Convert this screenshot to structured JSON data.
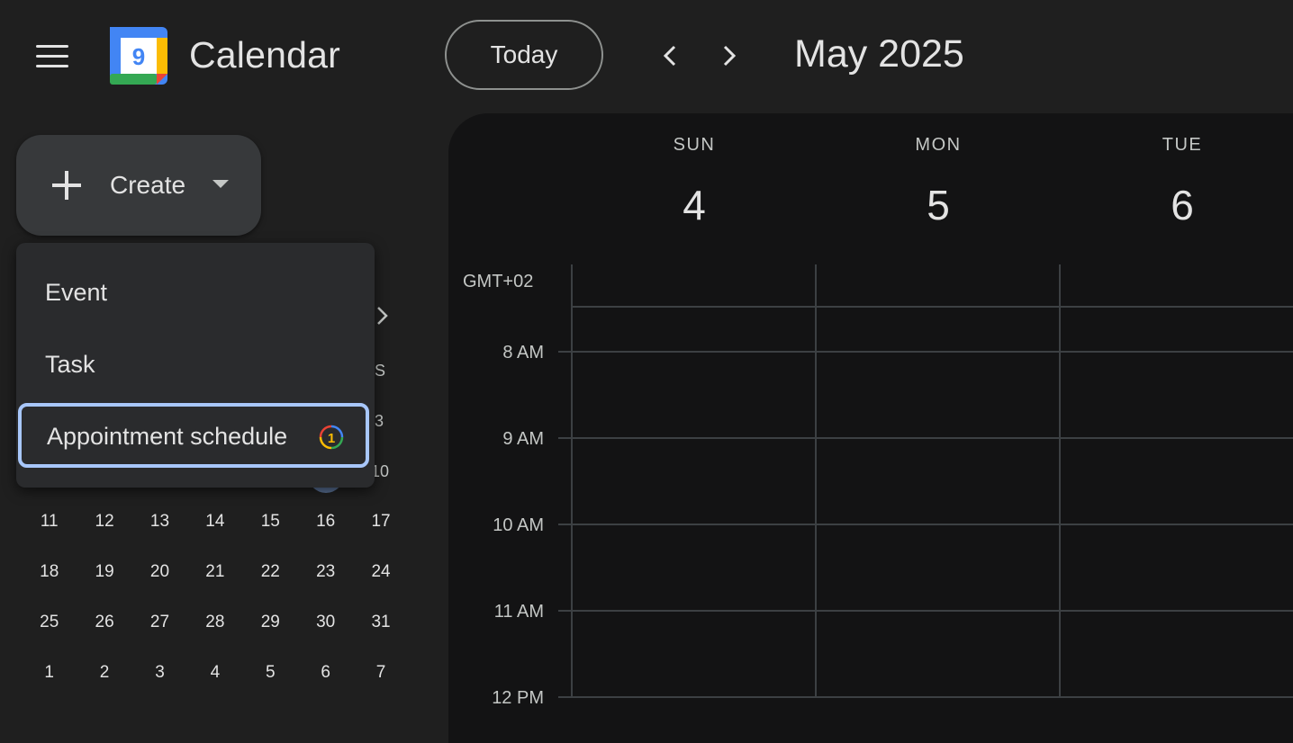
{
  "header": {
    "app_title": "Calendar",
    "logo_day": "9",
    "today_label": "Today",
    "month_label": "May 2025"
  },
  "create": {
    "label": "Create"
  },
  "dropdown": {
    "items": [
      {
        "label": "Event"
      },
      {
        "label": "Task"
      },
      {
        "label": "Appointment schedule",
        "badge": "1"
      }
    ]
  },
  "mini_calendar": {
    "partial_header": "S",
    "partial_col": [
      "3",
      "10"
    ],
    "weeks": [
      [
        "11",
        "12",
        "13",
        "14",
        "15",
        "16",
        "17"
      ],
      [
        "18",
        "19",
        "20",
        "21",
        "22",
        "23",
        "24"
      ],
      [
        "25",
        "26",
        "27",
        "28",
        "29",
        "30",
        "31"
      ],
      [
        "1",
        "2",
        "3",
        "4",
        "5",
        "6",
        "7"
      ]
    ]
  },
  "week_view": {
    "timezone": "GMT+02",
    "days": [
      {
        "name": "SUN",
        "num": "4"
      },
      {
        "name": "MON",
        "num": "5"
      },
      {
        "name": "TUE",
        "num": "6"
      }
    ],
    "hours": [
      "8 AM",
      "9 AM",
      "10 AM",
      "11 AM",
      "12 PM"
    ]
  },
  "colors": {
    "background": "#1f1f1f",
    "panel": "#131314",
    "focus_ring": "#a8c7fa",
    "logo_blue": "#4285f4",
    "logo_green": "#34a853",
    "logo_yellow": "#fbbc04",
    "logo_red": "#ea4335"
  }
}
